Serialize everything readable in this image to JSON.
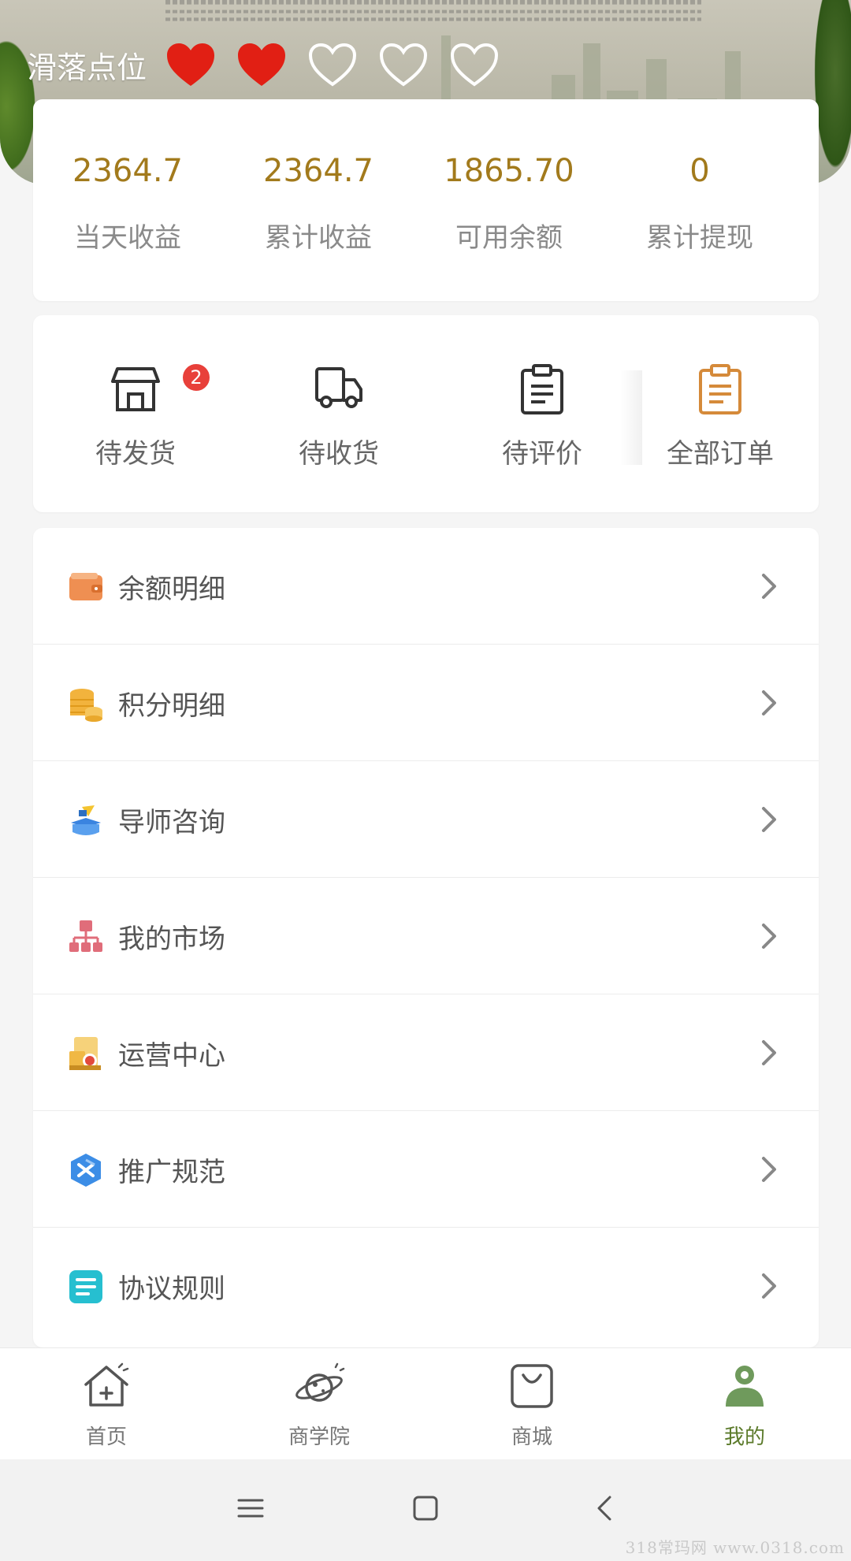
{
  "header": {
    "rating_label": "滑落点位",
    "rating": {
      "filled": 2,
      "total": 5
    }
  },
  "stats": [
    {
      "value": "2364.7",
      "label": "当天收益"
    },
    {
      "value": "2364.7",
      "label": "累计收益"
    },
    {
      "value": "1865.70",
      "label": "可用余额"
    },
    {
      "value": "0",
      "label": "累计提现"
    }
  ],
  "orders": [
    {
      "label": "待发货",
      "icon": "shop-icon",
      "badge": "2"
    },
    {
      "label": "待收货",
      "icon": "truck-icon"
    },
    {
      "label": "待评价",
      "icon": "clipboard-icon"
    },
    {
      "label": "全部订单",
      "icon": "clipboard-orange-icon"
    }
  ],
  "menu": [
    {
      "label": "余额明细",
      "icon": "wallet-icon"
    },
    {
      "label": "积分明细",
      "icon": "coins-icon"
    },
    {
      "label": "导师咨询",
      "icon": "mentor-icon"
    },
    {
      "label": "我的市场",
      "icon": "org-chart-icon"
    },
    {
      "label": "运营中心",
      "icon": "operation-center-icon"
    },
    {
      "label": "推广规范",
      "icon": "promotion-rules-icon"
    },
    {
      "label": "协议规则",
      "icon": "document-icon"
    }
  ],
  "tabbar": [
    {
      "label": "首页",
      "icon": "home-icon"
    },
    {
      "label": "商学院",
      "icon": "planet-icon"
    },
    {
      "label": "商城",
      "icon": "shopping-bag-icon"
    },
    {
      "label": "我的",
      "icon": "user-icon",
      "active": true
    }
  ],
  "watermark": "318常玛网 www.0318.com",
  "colors": {
    "accent_gold": "#a27a1c",
    "heart_red": "#e11f14",
    "active_tab": "#5b7a2a",
    "badge_red": "#e8403a"
  }
}
